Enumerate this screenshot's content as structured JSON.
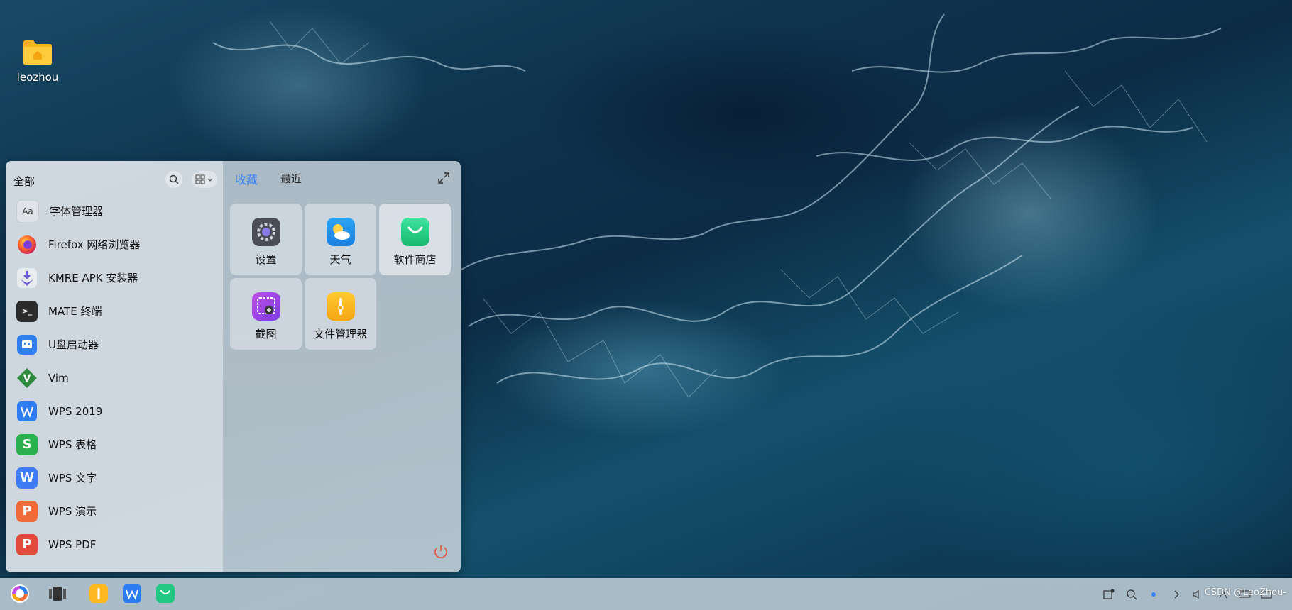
{
  "desktop": {
    "icon_label": "leozhou"
  },
  "start_menu": {
    "left_title": "全部",
    "apps": [
      {
        "label": "字体管理器",
        "icon": "font-manager-icon",
        "color": "#d8dde2"
      },
      {
        "label": "Firefox 网络浏览器",
        "icon": "firefox-icon",
        "color": "#ff6a2a"
      },
      {
        "label": "KMRE APK 安装器",
        "icon": "kmre-apk-icon",
        "color": "#6d5cd8"
      },
      {
        "label": "MATE 终端",
        "icon": "terminal-icon",
        "color": "#2a2a2a"
      },
      {
        "label": "U盘启动器",
        "icon": "usb-boot-icon",
        "color": "#2f7fec"
      },
      {
        "label": "Vim",
        "icon": "vim-icon",
        "color": "#2e8b3e"
      },
      {
        "label": "WPS 2019",
        "icon": "wps-2019-icon",
        "color": "#2d7cf2"
      },
      {
        "label": "WPS 表格",
        "icon": "wps-sheet-icon",
        "color": "#2ab14d"
      },
      {
        "label": "WPS 文字",
        "icon": "wps-writer-icon",
        "color": "#3e7cf4"
      },
      {
        "label": "WPS 演示",
        "icon": "wps-presentation-icon",
        "color": "#ef6b3a"
      },
      {
        "label": "WPS PDF",
        "icon": "wps-pdf-icon",
        "color": "#e24a3b"
      }
    ],
    "tabs": {
      "favorites": "收藏",
      "recent": "最近"
    },
    "favorites": [
      {
        "label": "设置",
        "icon": "settings-icon"
      },
      {
        "label": "天气",
        "icon": "weather-icon"
      },
      {
        "label": "软件商店",
        "icon": "software-store-icon"
      },
      {
        "label": "截图",
        "icon": "screenshot-icon"
      },
      {
        "label": "文件管理器",
        "icon": "file-manager-icon"
      }
    ]
  },
  "taskbar": {
    "watermark": "CSDN @LeoZhou-"
  },
  "colors": {
    "accent": "#3b82f6",
    "power": "#e05a3a"
  }
}
